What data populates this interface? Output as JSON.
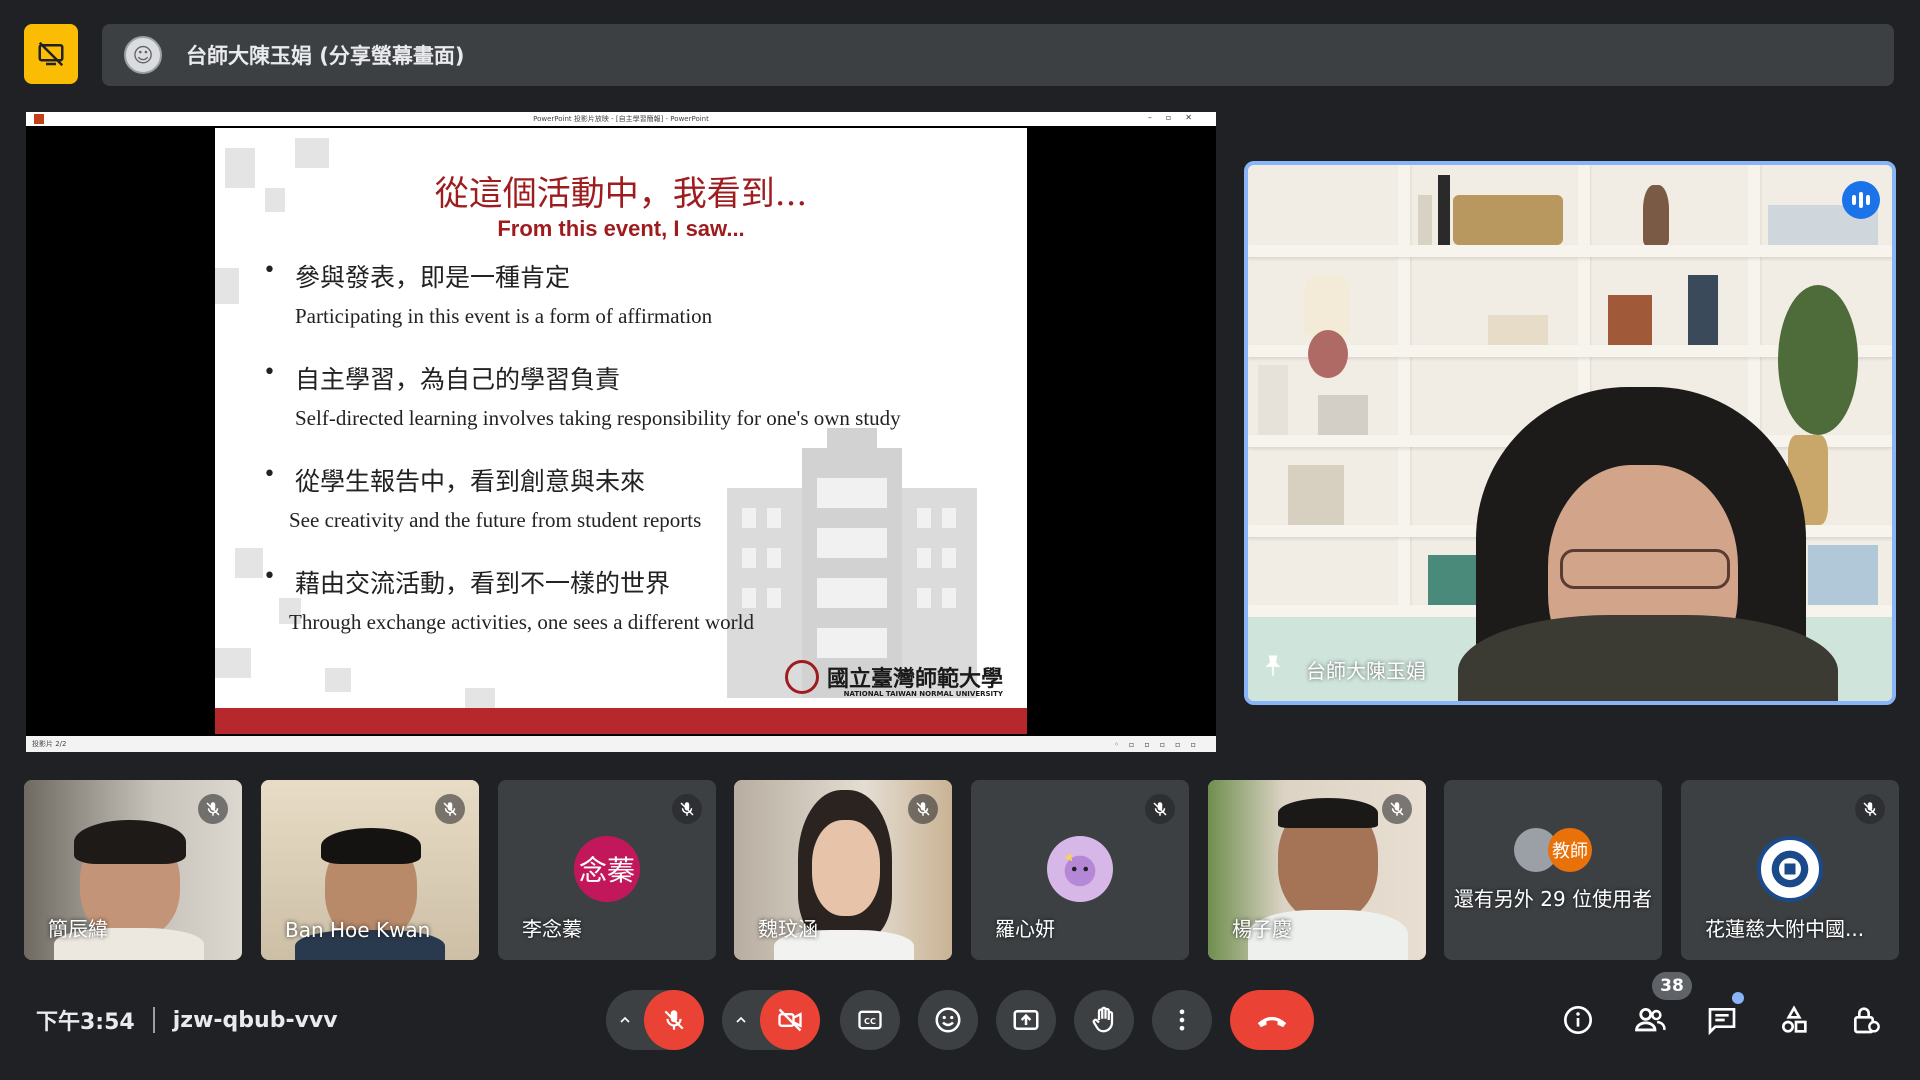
{
  "top_bar": {
    "presenter_title": "台師大陳玉娟 (分享螢幕畫面)"
  },
  "shared_screen": {
    "ppt_window_title": "PowerPoint 投影片放映 - [自主學習簡報] - PowerPoint",
    "slide_status": "投影片 2/2",
    "slide": {
      "title": "從這個活動中，我看到...",
      "subtitle": "From this event, I saw...",
      "bullets": [
        {
          "zh": "參與發表，即是一種肯定",
          "en": "Participating in this event is a form of affirmation"
        },
        {
          "zh": "自主學習，為自己的學習負責",
          "en": "Self-directed learning involves taking responsibility for one's own study"
        },
        {
          "zh": "從學生報告中，看到創意與未來",
          "en": "See creativity and the future from student reports"
        },
        {
          "zh": "藉由交流活動，看到不一樣的世界",
          "en": "Through exchange activities, one sees a different world"
        }
      ],
      "logo_name": "國立臺灣師範大學",
      "logo_english": "NATIONAL TAIWAN NORMAL UNIVERSITY"
    }
  },
  "presenter": {
    "name": "台師大陳玉娟"
  },
  "participants": [
    {
      "name": "簡辰緯"
    },
    {
      "name": "Ban Hoe Kwan"
    },
    {
      "name": "李念蓁",
      "initials": "念蓁"
    },
    {
      "name": "魏玟涵"
    },
    {
      "name": "羅心妍"
    },
    {
      "name": "楊子慶"
    },
    {
      "name": "還有另外 29 位使用者",
      "badge": "教師"
    },
    {
      "name": "花蓮慈大附中國..."
    }
  ],
  "bottom_bar": {
    "time": "下午3:54",
    "meeting_code": "jzw-qbub-vvv",
    "people_count": "38"
  },
  "colors": {
    "background": "#202124",
    "surface": "#3c4043",
    "accent_blue": "#8ab4f8",
    "danger_red": "#ea4335",
    "present_yellow": "#fbbc04",
    "slide_red": "#9e1b1e",
    "avatar_pink": "#c2185b",
    "badge_orange": "#e8710a"
  },
  "icons": [
    "present-off-icon",
    "mic-off-icon",
    "camera-off-icon",
    "captions-icon",
    "emoji-icon",
    "present-screen-icon",
    "raise-hand-icon",
    "more-options-icon",
    "leave-call-icon",
    "info-icon",
    "people-icon",
    "chat-icon",
    "activities-icon",
    "host-controls-icon",
    "pin-icon",
    "speaking-icon",
    "chevron-up-icon"
  ]
}
